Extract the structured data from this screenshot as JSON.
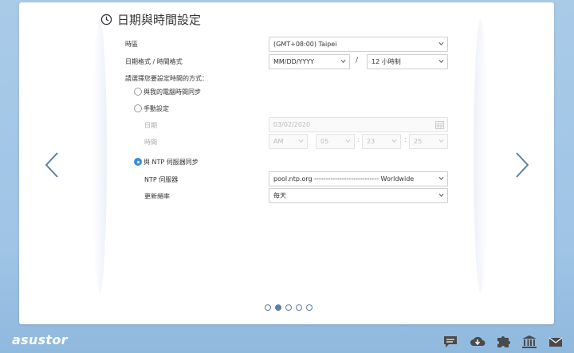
{
  "wizard": {
    "title": "日期與時間設定",
    "timezone_label": "時區",
    "timezone_value": "(GMT+08:00) Taipei",
    "format_label": "日期格式 / 時間格式",
    "date_format_value": "MM/DD/YYYY",
    "format_separator": "/",
    "time_format_value": "12 小時制",
    "choose_label": "請選擇您要設定時間的方式：",
    "options": {
      "sync_pc": "與我的電腦時間同步",
      "manual": "手動設定",
      "ntp": "與 NTP 伺服器同步"
    },
    "manual": {
      "date_label": "日期",
      "date_value": "03/02/2020",
      "time_label": "時間",
      "ampm": "AM",
      "hour": "05",
      "minute": "23",
      "second": "25",
      "colon": ":"
    },
    "ntp": {
      "server_label": "NTP 伺服器",
      "server_value": "pool.ntp.org ---------------------------- Worldwide",
      "frequency_label": "更新頻率",
      "frequency_value": "每天"
    },
    "selected_option": "ntp",
    "page_count": 5,
    "current_page": 2
  },
  "footer": {
    "logo": "asustor",
    "icons": [
      "chat-icon",
      "cloud-download-icon",
      "puzzle-icon",
      "bank-icon",
      "mail-icon"
    ]
  },
  "colors": {
    "accent": "#3a8dde",
    "background": "#a9cbe8",
    "nav_arrow": "#5b7fa6"
  }
}
